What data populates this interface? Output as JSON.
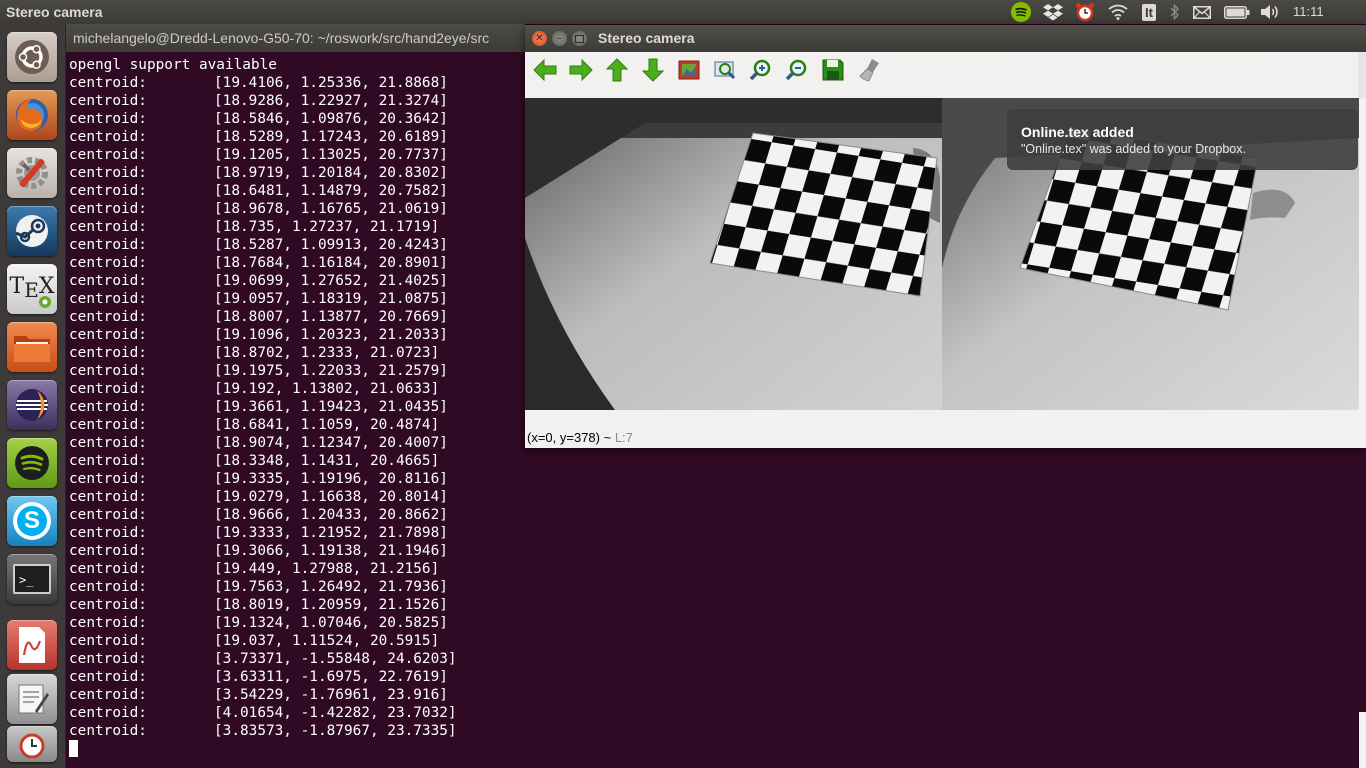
{
  "panel": {
    "title": "Stereo camera",
    "clock": "11:11",
    "keyboard_layout": "It",
    "tray_icons": [
      "spotify-icon",
      "dropbox-icon",
      "alarm-clock-icon",
      "wifi-icon",
      "keyboard-layout-icon",
      "bluetooth-icon",
      "mail-icon",
      "battery-icon",
      "volume-icon"
    ]
  },
  "launcher": {
    "items": [
      {
        "name": "ubuntu-dash-icon",
        "color": "#8a6a55"
      },
      {
        "name": "firefox-icon",
        "color": "#c9572a"
      },
      {
        "name": "system-settings-icon",
        "color": "#b24a2c"
      },
      {
        "name": "steam-icon",
        "color": "#2b5e86"
      },
      {
        "name": "texmaker-icon",
        "color": "#cfcfcf"
      },
      {
        "name": "files-icon",
        "color": "#e0672a"
      },
      {
        "name": "eclipse-icon",
        "color": "#4b3a6b"
      },
      {
        "name": "spotify-launcher-icon",
        "color": "#7fb522"
      },
      {
        "name": "skype-icon",
        "color": "#1fa3de"
      },
      {
        "name": "terminal-icon",
        "color": "#4a4a4a"
      },
      {
        "name": "document-viewer-icon",
        "color": "#c9473f"
      },
      {
        "name": "text-editor-icon",
        "color": "#9a9a9a"
      }
    ]
  },
  "terminal": {
    "title": "michelangelo@Dredd-Lenovo-G50-70: ~/roswork/src/hand2eye/src",
    "first_line": "opengl support available",
    "label": "centroid:",
    "values": [
      "[19.4106, 1.25336, 21.8868]",
      "[18.9286, 1.22927, 21.3274]",
      "[18.5846, 1.09876, 20.3642]",
      "[18.5289, 1.17243, 20.6189]",
      "[19.1205, 1.13025, 20.7737]",
      "[18.9719, 1.20184, 20.8302]",
      "[18.6481, 1.14879, 20.7582]",
      "[18.9678, 1.16765, 21.0619]",
      "[18.735, 1.27237, 21.1719]",
      "[18.5287, 1.09913, 20.4243]",
      "[18.7684, 1.16184, 20.8901]",
      "[19.0699, 1.27652, 21.4025]",
      "[19.0957, 1.18319, 21.0875]",
      "[18.8007, 1.13877, 20.7669]",
      "[19.1096, 1.20323, 21.2033]",
      "[18.8702, 1.2333, 21.0723]",
      "[19.1975, 1.22033, 21.2579]",
      "[19.192, 1.13802, 21.0633]",
      "[19.3661, 1.19423, 21.0435]",
      "[18.6841, 1.1059, 20.4874]",
      "[18.9074, 1.12347, 20.4007]",
      "[18.3348, 1.1431, 20.4665]",
      "[19.3335, 1.19196, 20.8116]",
      "[19.0279, 1.16638, 20.8014]",
      "[18.9666, 1.20433, 20.8662]",
      "[19.3333, 1.21952, 21.7898]",
      "[19.3066, 1.19138, 21.1946]",
      "[19.449, 1.27988, 21.2156]",
      "[19.7563, 1.26492, 21.7936]",
      "[18.8019, 1.20959, 21.1526]",
      "[19.1324, 1.07046, 20.5825]",
      "[19.037, 1.11524, 20.5915]",
      "[3.73371, -1.55848, 24.6203]",
      "[3.63311, -1.6975, 22.7619]",
      "[3.54229, -1.76961, 23.916]",
      "[4.01654, -1.42282, 23.7032]",
      "[3.83573, -1.87967, 23.7335]"
    ]
  },
  "stereo_window": {
    "title": "Stereo camera",
    "toolbar": [
      "pan-left-icon",
      "pan-right-icon",
      "pan-up-icon",
      "pan-down-icon",
      "zoom-to-window-icon",
      "zoom-to-fit-icon",
      "zoom-in-icon",
      "zoom-out-icon",
      "save-icon",
      "properties-icon"
    ],
    "status_coords": "(x=0, y=378) ~",
    "status_level": "L:7"
  },
  "notification": {
    "title": "Online.tex added",
    "body": "\"Online.tex\" was added to your Dropbox."
  },
  "colors": {
    "terminal_bg": "#300a24",
    "toolbar_green": "#4caf1a",
    "panel_bg": "#3c3b37",
    "close_button": "#e8663d"
  }
}
